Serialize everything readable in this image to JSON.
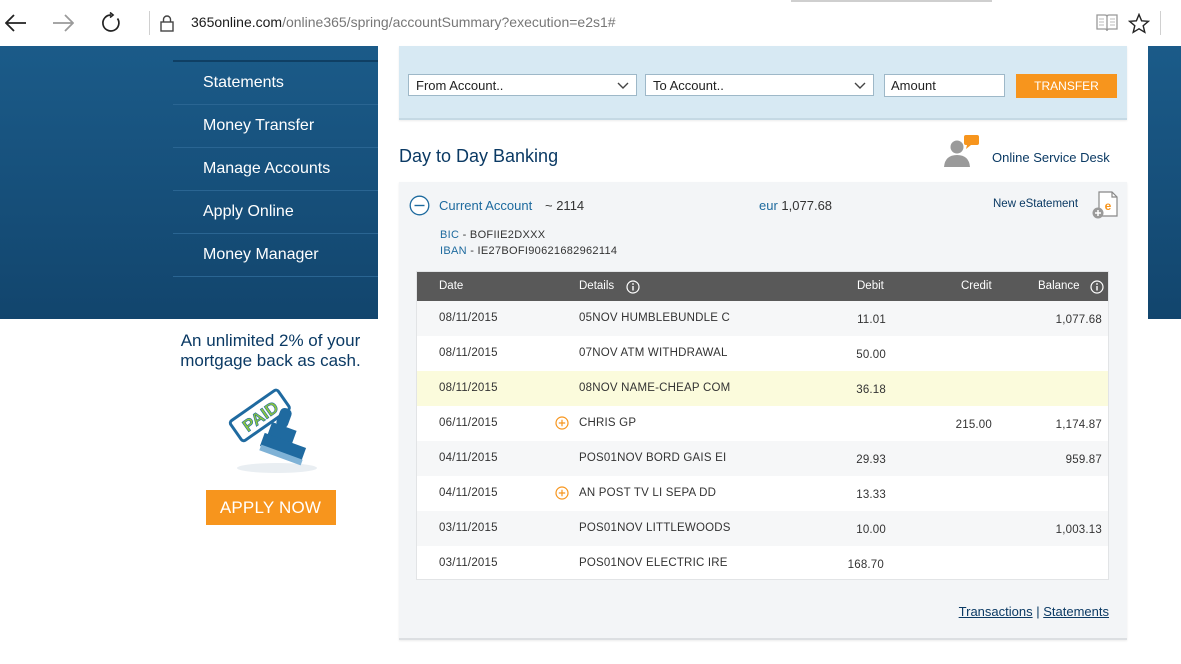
{
  "browser": {
    "url_host": "365online.com",
    "url_path": "/online365/spring/accountSummary?execution=e2s1#"
  },
  "sidebar": {
    "items": [
      {
        "label": "Statements"
      },
      {
        "label": "Money Transfer"
      },
      {
        "label": "Manage Accounts"
      },
      {
        "label": "Apply Online"
      },
      {
        "label": "Money Manager"
      }
    ]
  },
  "promo": {
    "text": "An unlimited 2% of your mortgage back as cash.",
    "stamp_text": "PAID",
    "button_label": "APPLY NOW"
  },
  "transfer": {
    "from_label": "From Account..",
    "to_label": "To Account..",
    "amount_placeholder": "Amount",
    "button_label": "TRANSFER"
  },
  "section": {
    "title": "Day to Day Banking",
    "service_desk_label": "Online Service Desk"
  },
  "account": {
    "name": "Current Account",
    "number": "~ 2114",
    "currency": "eur",
    "balance": "1,077.68",
    "new_estatement": "New eStatement",
    "bic_label": "BIC",
    "bic_value": "- BOFIIE2DXXX",
    "iban_label": "IBAN",
    "iban_value": "- IE27BOFI90621682962114"
  },
  "table": {
    "headers": {
      "date": "Date",
      "details": "Details",
      "debit": "Debit",
      "credit": "Credit",
      "balance": "Balance"
    },
    "rows": [
      {
        "date": "08/11/2015",
        "details": "05NOV HUMBLEBUNDLE C",
        "debit": "11.01",
        "credit": "",
        "balance": "1,077.68"
      },
      {
        "date": "08/11/2015",
        "details": "07NOV ATM WITHDRAWAL",
        "debit": "50.00",
        "credit": "",
        "balance": ""
      },
      {
        "date": "08/11/2015",
        "details": "08NOV NAME-CHEAP COM",
        "debit": "36.18",
        "credit": "",
        "balance": ""
      },
      {
        "date": "06/11/2015",
        "details": "CHRIS GP",
        "debit": "",
        "credit": "215.00",
        "balance": "1,174.87"
      },
      {
        "date": "04/11/2015",
        "details": "POS01NOV BORD GAIS EI",
        "debit": "29.93",
        "credit": "",
        "balance": "959.87"
      },
      {
        "date": "04/11/2015",
        "details": "AN POST TV LI SEPA DD",
        "debit": "13.33",
        "credit": "",
        "balance": ""
      },
      {
        "date": "03/11/2015",
        "details": "POS01NOV LITTLEWOODS",
        "debit": "10.00",
        "credit": "",
        "balance": "1,003.13"
      },
      {
        "date": "03/11/2015",
        "details": "POS01NOV ELECTRIC IRE",
        "debit": "168.70",
        "credit": "",
        "balance": ""
      }
    ]
  },
  "footer": {
    "transactions_link": "Transactions",
    "separator": "|",
    "statements_link": "Statements"
  },
  "colors": {
    "brand_blue": "#15507c",
    "accent_orange": "#f7951d",
    "link_blue": "#1d6a9e",
    "highlight_row": "#fbfbdc"
  }
}
